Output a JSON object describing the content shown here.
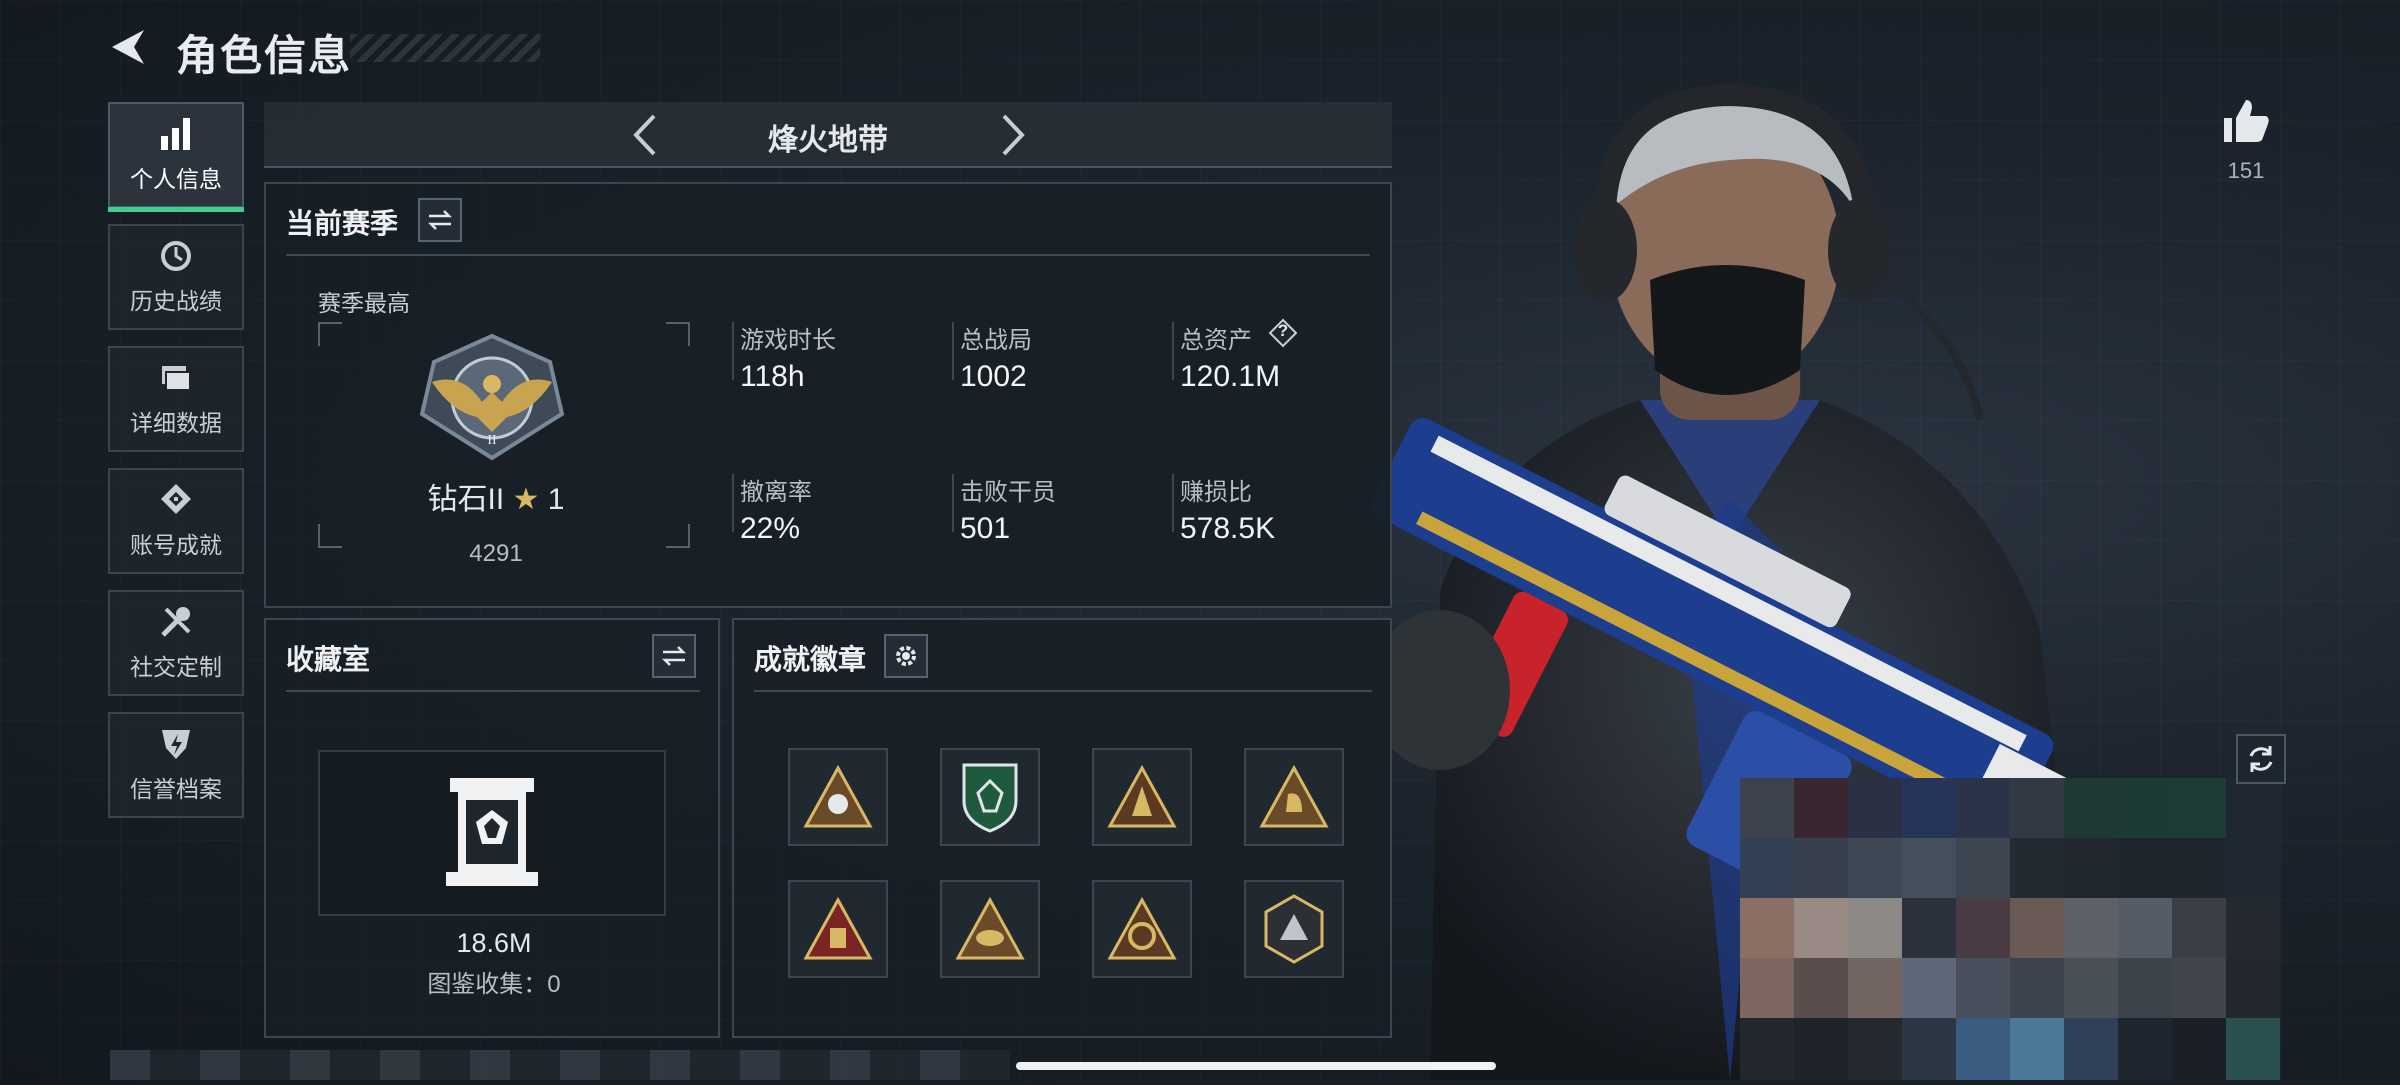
{
  "header": {
    "title": "角色信息"
  },
  "nav": [
    {
      "label": "个人信息",
      "icon": "bar-chart-icon",
      "active": true
    },
    {
      "label": "历史战绩",
      "icon": "history-icon"
    },
    {
      "label": "详细数据",
      "icon": "folders-icon"
    },
    {
      "label": "账号成就",
      "icon": "achievement-icon"
    },
    {
      "label": "社交定制",
      "icon": "tools-icon"
    },
    {
      "label": "信誉档案",
      "icon": "shield-bolt-icon"
    }
  ],
  "mode": {
    "name": "烽火地带"
  },
  "season": {
    "title": "当前赛季",
    "best_label": "赛季最高",
    "rank_name": "钻石II",
    "rank_stars": "1",
    "rank_score": "4291",
    "stats": [
      {
        "label": "游戏时长",
        "value": "118h"
      },
      {
        "label": "总战局",
        "value": "1002"
      },
      {
        "label": "总资产",
        "value": "120.1M",
        "help": "?"
      },
      {
        "label": "撤离率",
        "value": "22%"
      },
      {
        "label": "击败干员",
        "value": "501"
      },
      {
        "label": "赚损比",
        "value": "578.5K"
      }
    ]
  },
  "collection": {
    "title": "收藏室",
    "value": "18.6M",
    "codex_label": "图鉴收集：0"
  },
  "achievements": {
    "title": "成就徽章",
    "badge_count": 8
  },
  "likes": {
    "count": "151"
  },
  "colors": {
    "accent": "#3ccf8e",
    "panel": "#181f26",
    "border": "#3b4650"
  }
}
